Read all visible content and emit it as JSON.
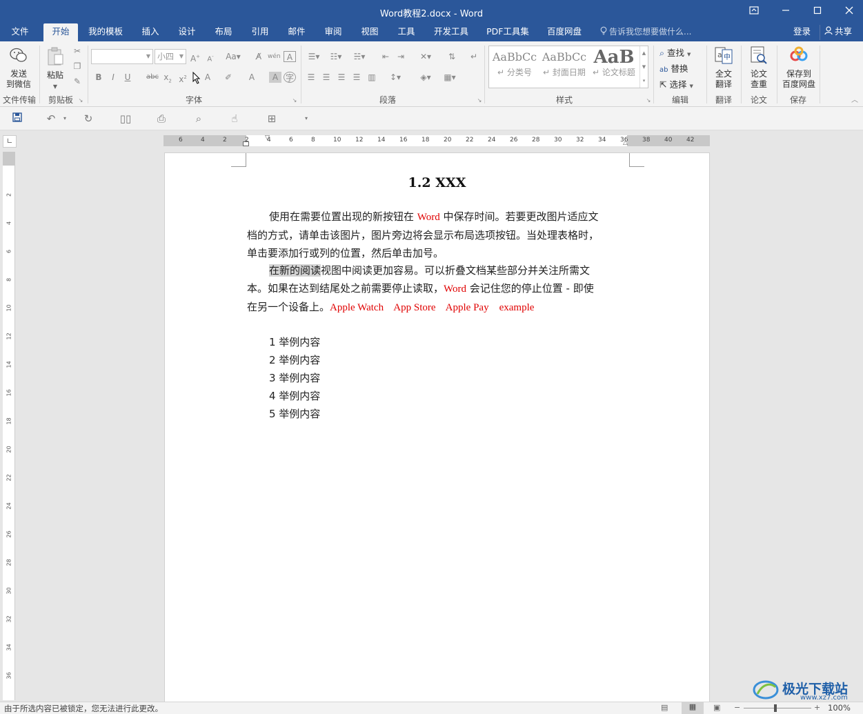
{
  "window": {
    "title": "Word教程2.docx - Word"
  },
  "tabs": [
    "文件",
    "开始",
    "我的模板",
    "插入",
    "设计",
    "布局",
    "引用",
    "邮件",
    "审阅",
    "视图",
    "工具",
    "开发工具",
    "PDF工具集",
    "百度网盘"
  ],
  "tell_me": "告诉我您想要做什么...",
  "account": {
    "login": "登录",
    "share": "共享"
  },
  "ribbon": {
    "send": {
      "label1": "发送",
      "label2": "到微信",
      "group": "文件传输"
    },
    "clipboard": {
      "paste": "粘贴",
      "group": "剪贴板"
    },
    "font": {
      "font_name": "",
      "font_size": "小四",
      "group": "字体"
    },
    "paragraph": {
      "group": "段落"
    },
    "styles": {
      "group": "样式",
      "items": [
        {
          "sample": "AaBbCc",
          "name": "分类号"
        },
        {
          "sample": "AaBbCc",
          "name": "封面日期"
        },
        {
          "sample": "AaB",
          "name": "论文标题"
        }
      ]
    },
    "editing": {
      "find": "查找",
      "replace": "替换",
      "select": "选择",
      "group": "编辑"
    },
    "translate": {
      "label1": "全文",
      "label2": "翻译",
      "group": "翻译"
    },
    "thesis": {
      "label1": "论文",
      "label2": "查重",
      "group": "论文"
    },
    "save": {
      "label1": "保存到",
      "label2": "百度网盘",
      "group": "保存"
    }
  },
  "ruler": {
    "h_numbers": [
      "6",
      "4",
      "2",
      "2",
      "4",
      "6",
      "8",
      "10",
      "12",
      "14",
      "16",
      "18",
      "20",
      "22",
      "24",
      "26",
      "28",
      "30",
      "32",
      "34",
      "36",
      "38",
      "40",
      "42"
    ],
    "v_numbers": [
      "2",
      "4",
      "6",
      "8",
      "10",
      "12",
      "14",
      "16",
      "18",
      "20",
      "22",
      "24",
      "26",
      "28",
      "30",
      "32",
      "34",
      "36"
    ]
  },
  "document": {
    "heading": "1.2 XXX",
    "para1": {
      "l1_a": "使用在需要位置出现的新按钮在",
      "l1_word": "Word",
      "l1_b": "中保存时间。若要更改图片适应文",
      "l2": "档的方式，请单击该图片，图片旁边将会显示布局选项按钮。当处理表格时，",
      "l3": "单击要添加行或列的位置，然后单击加号。"
    },
    "para2": {
      "l1_sel": "在新的阅读",
      "l1_rest": "视图中阅读更加容易。可以折叠文档某些部分并关注所需文",
      "l2_a": "本。如果在达到结尾处之前需要停止读取，",
      "l2_word": "Word",
      "l2_b": "会记住您的停止位置 - 即使",
      "l3_a": "在另一个设备上。",
      "l3_red": "Apple Watch    App Store    Apple Pay    example"
    },
    "list": [
      "1 举例内容",
      "2 举例内容",
      "3 举例内容",
      "4 举例内容",
      "5 举例内容"
    ]
  },
  "status": {
    "message": "由于所选内容已被锁定，您无法进行此更改。",
    "zoom": "100%"
  },
  "watermark": {
    "text": "极光下载站",
    "url": "www.xz7.com"
  },
  "colors": {
    "brand": "#2b579a",
    "red_text": "#e00000"
  }
}
